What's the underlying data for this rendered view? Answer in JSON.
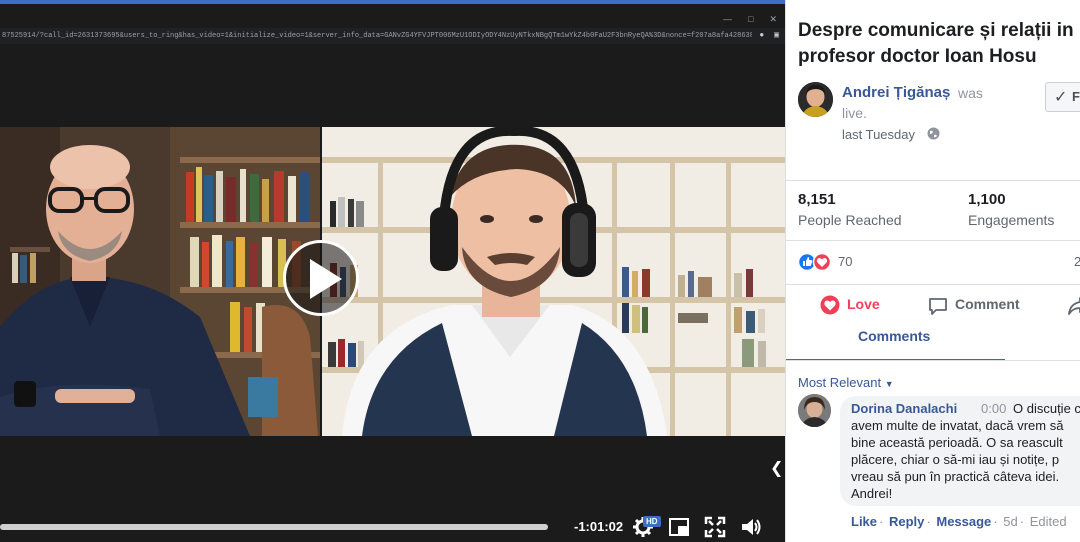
{
  "browser": {
    "url": "87525914/?call_id=2631373695&users_to_ring&has_video=1&initialize_video=1&server_info_data=GANvZG4YFVJPT006MzU1ODIyODY4NzUyNTkxNBgQTm1wYkZ4b0FaU2F3bnRyeQA%3D&nonce=f207a8afa428638&ext=1586267895&hash=AeRWui..."
  },
  "video": {
    "time_remaining": "-1:01:02",
    "hd_badge": "HD",
    "progress_percent": 100
  },
  "post": {
    "title": "Despre comunicare și relații in profesor doctor Ioan Hosu",
    "author": "Andrei Țigănaș",
    "was": "was",
    "live": "live.",
    "time": "last Tuesday",
    "follow_label": "F"
  },
  "stats": {
    "reached_value": "8,151",
    "reached_label": "People Reached",
    "engagements_value": "1,100",
    "engagements_label": "Engagements"
  },
  "reactions": {
    "count": "70",
    "shares_partial": "2"
  },
  "actions": {
    "love": "Love",
    "comment": "Comment"
  },
  "comments": {
    "tab_label": "Comments",
    "sort_label": "Most Relevant",
    "items": [
      {
        "author": "Dorina Danalachi",
        "timestamp": "0:00",
        "lines": [
          "O discuție c",
          "avem multe de invatat, dacă vrem să",
          "bine această perioadă. O sa reascult",
          "plăcere, chiar o să-mi iau și notițe, p",
          "vreau să pun în practică câteva idei.",
          "Andrei!"
        ],
        "like": "Like",
        "reply": "Reply",
        "message": "Message",
        "age": "5d",
        "edited": "Edited"
      }
    ]
  }
}
